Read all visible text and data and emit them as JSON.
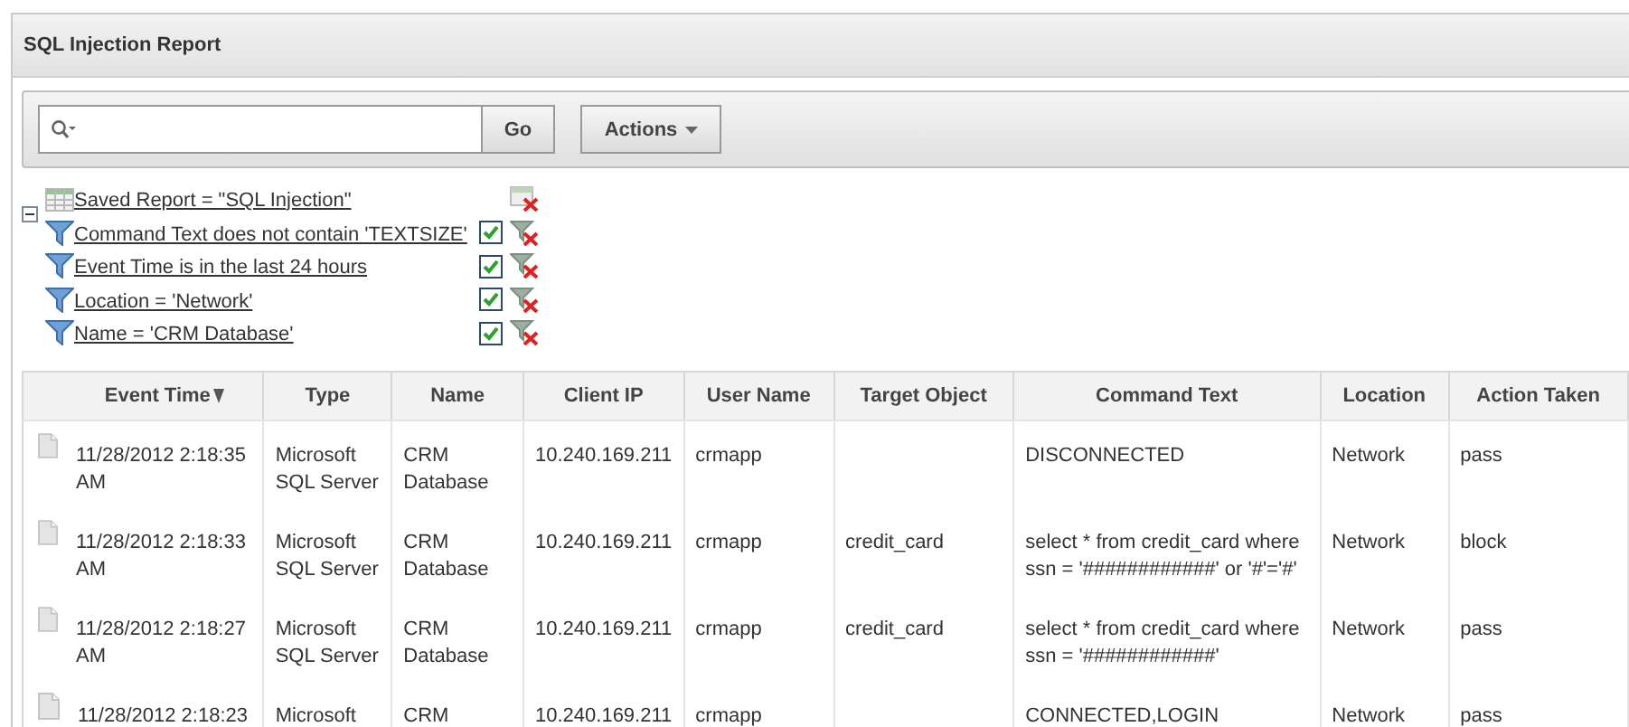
{
  "panel": {
    "title": "SQL Injection Report"
  },
  "toolbar": {
    "go_button": "Go",
    "actions_button": "Actions"
  },
  "filters": {
    "expanded": true,
    "items": [
      {
        "kind": "saved",
        "label": "Saved Report = \"SQL Injection\""
      },
      {
        "kind": "filter",
        "label": "Command Text does not contain 'TEXTSIZE'",
        "enabled": true
      },
      {
        "kind": "filter",
        "label": "Event Time is in the last 24 hours",
        "enabled": true
      },
      {
        "kind": "filter",
        "label": "Location = 'Network'",
        "enabled": true
      },
      {
        "kind": "filter",
        "label": "Name = 'CRM Database'",
        "enabled": true
      }
    ]
  },
  "table": {
    "columns": [
      {
        "label": "Event Time",
        "sorted": true
      },
      {
        "label": "Type",
        "sorted": false
      },
      {
        "label": "Name",
        "sorted": false
      },
      {
        "label": "Client IP",
        "sorted": false
      },
      {
        "label": "User Name",
        "sorted": false
      },
      {
        "label": "Target Object",
        "sorted": false
      },
      {
        "label": "Command Text",
        "sorted": false
      },
      {
        "label": "Location",
        "sorted": false
      },
      {
        "label": "Action Taken",
        "sorted": false
      }
    ],
    "rows": [
      [
        "11/28/2012 2:18:35 AM",
        "Microsoft SQL Server",
        "CRM Database",
        "10.240.169.211",
        "crmapp",
        "",
        "DISCONNECTED",
        "Network",
        "pass"
      ],
      [
        "11/28/2012 2:18:33 AM",
        "Microsoft SQL Server",
        "CRM Database",
        "10.240.169.211",
        "crmapp",
        "credit_card",
        "select * from credit_card where ssn = '############' or '#'='#'",
        "Network",
        "block"
      ],
      [
        "11/28/2012 2:18:27 AM",
        "Microsoft SQL Server",
        "CRM Database",
        "10.240.169.211",
        "crmapp",
        "credit_card",
        "select * from credit_card where ssn = '############'",
        "Network",
        "pass"
      ],
      [
        "11/28/2012 2:18:23",
        "Microsoft",
        "CRM",
        "10.240.169.211",
        "crmapp",
        "",
        "CONNECTED,LOGIN",
        "Network",
        "pass"
      ]
    ]
  }
}
